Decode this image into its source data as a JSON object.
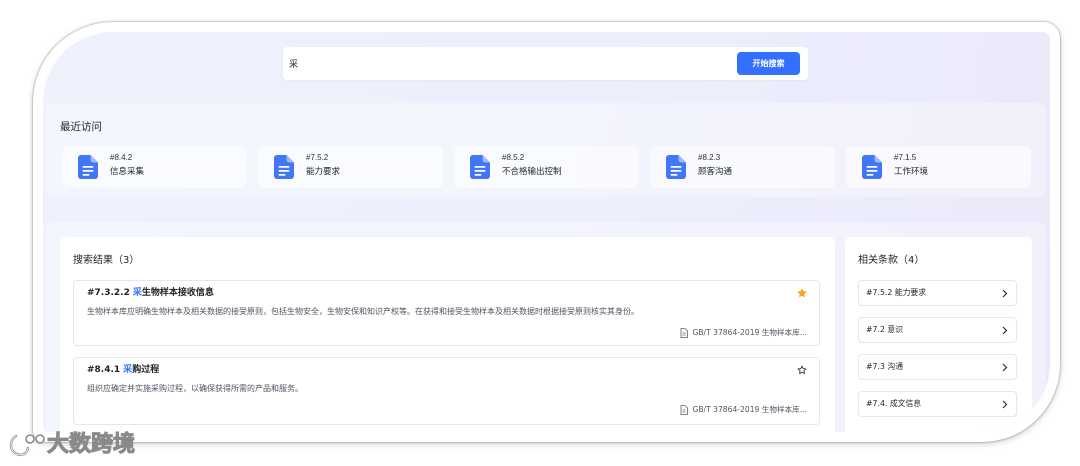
{
  "search": {
    "value": "采",
    "button_label": "开始搜索"
  },
  "recent": {
    "title": "最近访问",
    "items": [
      {
        "code": "#8.4.2",
        "label": "信息采集"
      },
      {
        "code": "#7.5.2",
        "label": "能力要求"
      },
      {
        "code": "#8.5.2",
        "label": "不合格输出控制"
      },
      {
        "code": "#8.2.3",
        "label": "顾客沟通"
      },
      {
        "code": "#7.1.5",
        "label": "工作环境"
      }
    ]
  },
  "results": {
    "title": "搜索结果（3）",
    "items": [
      {
        "code": "#7.3.2.2",
        "keyword": "采",
        "rest": "生物样本接收信息",
        "starred": true,
        "description": "生物样本库应明确生物样本及相关数据的接受原则，包括生物安全，生物安保和知识产权等。在获得和接受生物样本及相关数据时根据接受原则核实其身份。",
        "source": "GB/T 37864-2019 生物样本库..."
      },
      {
        "code": "#8.4.1",
        "keyword": "采",
        "rest": "购过程",
        "starred": false,
        "description": "组织应确定并实施采购过程，以确保获得所需的产品和服务。",
        "source": "GB/T 37864-2019 生物样本库..."
      }
    ]
  },
  "related": {
    "title": "相关条款（4）",
    "items": [
      {
        "label": "#7.5.2 能力要求"
      },
      {
        "label": "#7.2 意识"
      },
      {
        "label": "#7.3 沟通"
      },
      {
        "label": "#7.4. 成文信息"
      }
    ]
  },
  "watermark": {
    "text": "大数跨境"
  },
  "icons": {
    "recent_item": "document-icon",
    "result_source": "document-outline-icon",
    "starred": "star-filled-icon",
    "unstarred": "star-outline-icon",
    "related_item": "chevron-right-icon"
  },
  "colors": {
    "accent": "#3370ff",
    "star": "#f5a623"
  }
}
